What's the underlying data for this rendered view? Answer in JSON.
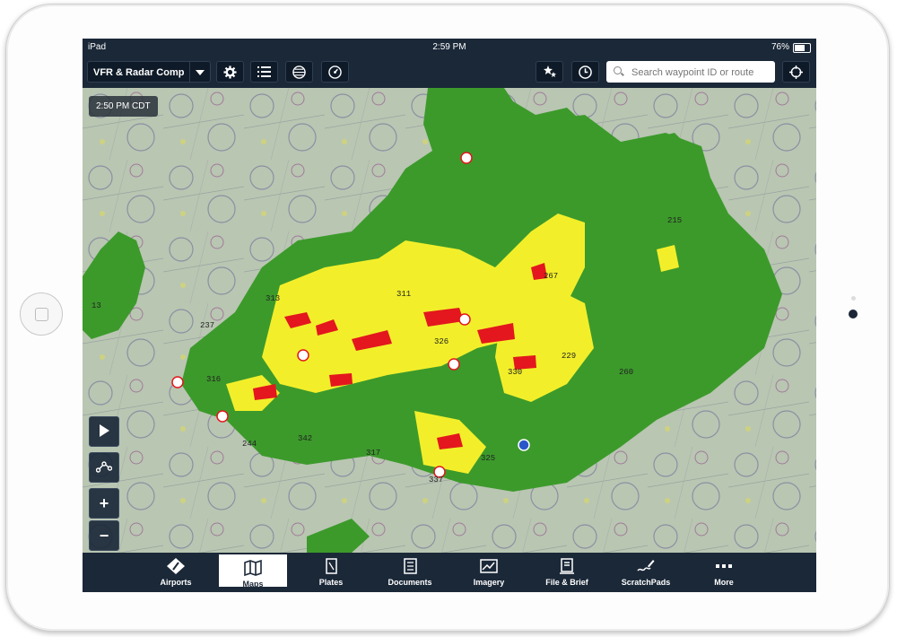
{
  "status_bar": {
    "device": "iPad",
    "time": "2:59 PM",
    "battery": "76%",
    "battery_level": 0.76
  },
  "toolbar": {
    "layer_selector": "VFR & Radar Comp",
    "search_placeholder": "Search waypoint ID or route"
  },
  "map": {
    "timestamp": "2:50 PM CDT",
    "labels": [
      "313",
      "311",
      "267",
      "215",
      "237",
      "326",
      "330",
      "229",
      "260",
      "316",
      "244",
      "342",
      "317",
      "325",
      "337",
      "13"
    ],
    "controls": {
      "zoom_in": "+",
      "zoom_out": "−"
    }
  },
  "tabs": [
    {
      "label": "Airports",
      "icon": "airport-icon"
    },
    {
      "label": "Maps",
      "icon": "map-icon",
      "active": true
    },
    {
      "label": "Plates",
      "icon": "plates-icon"
    },
    {
      "label": "Documents",
      "icon": "documents-icon"
    },
    {
      "label": "Imagery",
      "icon": "imagery-icon"
    },
    {
      "label": "File & Brief",
      "icon": "file-brief-icon"
    },
    {
      "label": "ScratchPads",
      "icon": "scratchpad-icon"
    },
    {
      "label": "More",
      "icon": "more-icon"
    }
  ],
  "colors": {
    "chrome": "#1b2838",
    "radar_green": "#3c9a2b",
    "radar_yellow": "#f2ef2a",
    "radar_red": "#e3171d"
  }
}
